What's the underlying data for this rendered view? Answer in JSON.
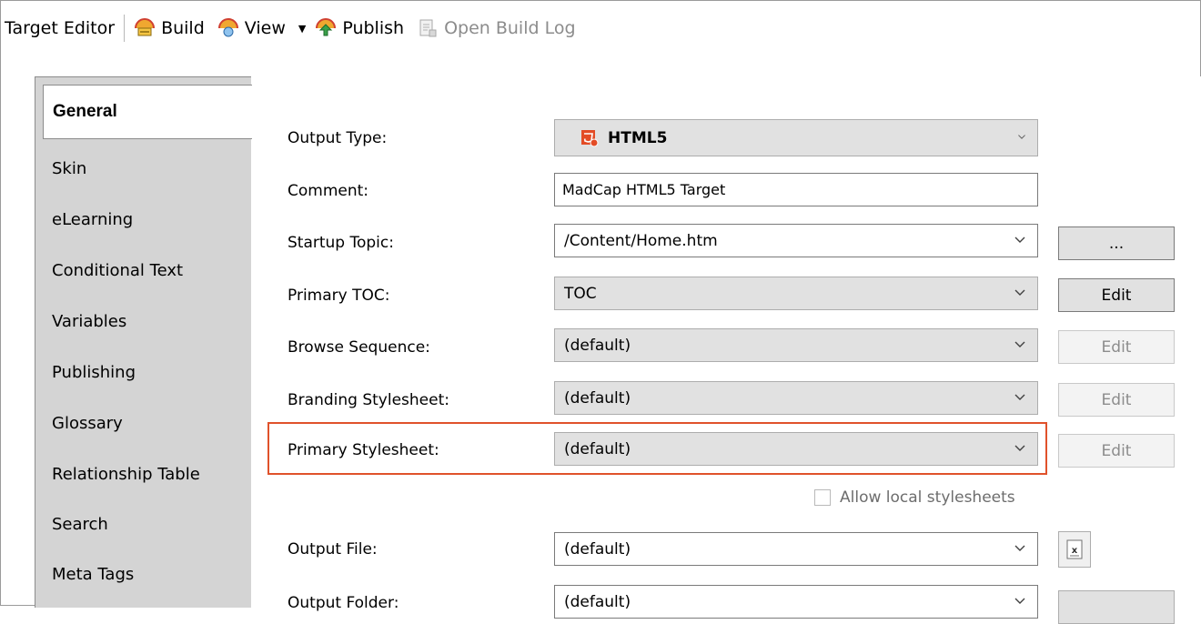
{
  "toolbar": {
    "title": "Target Editor",
    "build": "Build",
    "view": "View",
    "publish": "Publish",
    "open_build_log": "Open Build Log"
  },
  "tabs": [
    "General",
    "Skin",
    "eLearning",
    "Conditional Text",
    "Variables",
    "Publishing",
    "Glossary",
    "Relationship Table",
    "Search",
    "Meta Tags"
  ],
  "form": {
    "output_type_label": "Output Type:",
    "output_type_value": "HTML5",
    "comment_label": "Comment:",
    "comment_value": "MadCap HTML5 Target",
    "startup_topic_label": "Startup Topic:",
    "startup_topic_value": "/Content/Home.htm",
    "startup_topic_browse": "...",
    "primary_toc_label": "Primary TOC:",
    "primary_toc_value": "TOC",
    "browse_sequence_label": "Browse Sequence:",
    "browse_sequence_value": "(default)",
    "branding_stylesheet_label": "Branding Stylesheet:",
    "branding_stylesheet_value": "(default)",
    "primary_stylesheet_label": "Primary Stylesheet:",
    "primary_stylesheet_value": "(default)",
    "allow_local_stylesheets": "Allow local stylesheets",
    "output_file_label": "Output File:",
    "output_file_value": "(default)",
    "output_folder_label": "Output Folder:",
    "output_folder_value": "(default)",
    "edit": "Edit"
  },
  "colors": {
    "highlight": "#e0522b",
    "html5_icon": "#e34c26"
  }
}
